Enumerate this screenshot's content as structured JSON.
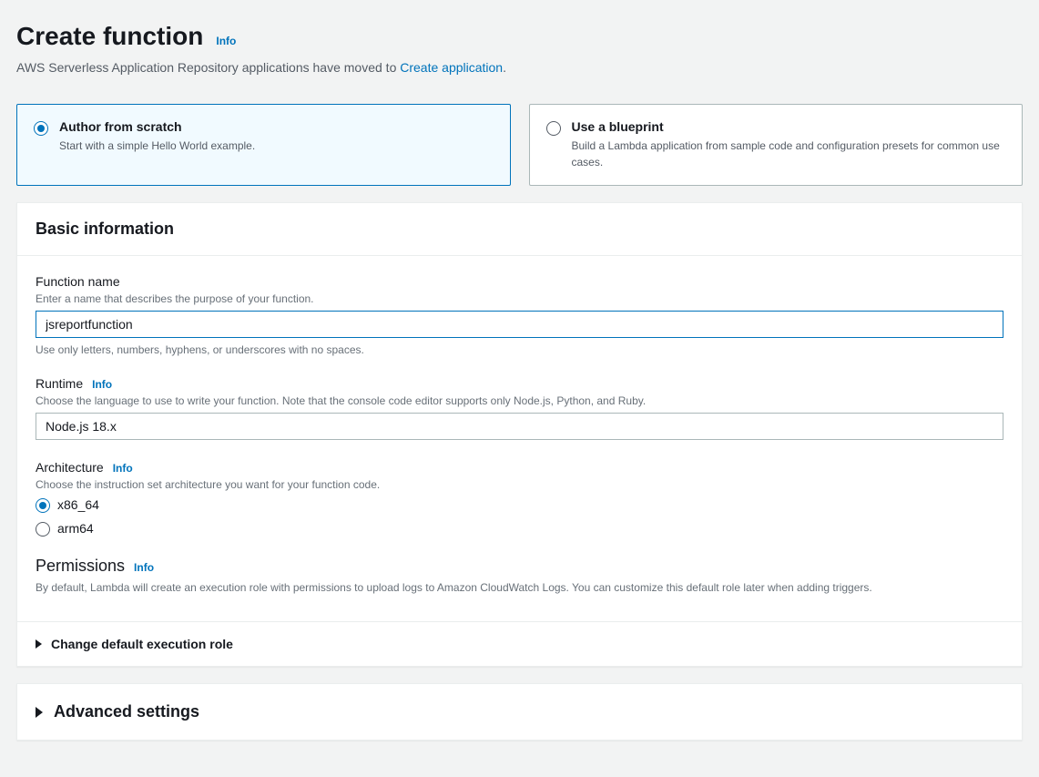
{
  "header": {
    "title": "Create function",
    "info": "Info",
    "subtext_prefix": "AWS Serverless Application Repository applications have moved to ",
    "subtext_link": "Create application",
    "subtext_suffix": "."
  },
  "options": {
    "author": {
      "title": "Author from scratch",
      "desc": "Start with a simple Hello World example.",
      "selected": true
    },
    "blueprint": {
      "title": "Use a blueprint",
      "desc": "Build a Lambda application from sample code and configuration presets for common use cases.",
      "selected": false
    }
  },
  "basic": {
    "heading": "Basic information",
    "function_name": {
      "label": "Function name",
      "hint": "Enter a name that describes the purpose of your function.",
      "value": "jsreportfunction",
      "help": "Use only letters, numbers, hyphens, or underscores with no spaces."
    },
    "runtime": {
      "label": "Runtime",
      "info": "Info",
      "hint": "Choose the language to use to write your function. Note that the console code editor supports only Node.js, Python, and Ruby.",
      "value": "Node.js 18.x"
    },
    "architecture": {
      "label": "Architecture",
      "info": "Info",
      "hint": "Choose the instruction set architecture you want for your function code.",
      "options": {
        "x86": "x86_64",
        "arm": "arm64"
      },
      "selected": "x86"
    },
    "permissions": {
      "label": "Permissions",
      "info": "Info",
      "desc": "By default, Lambda will create an execution role with permissions to upload logs to Amazon CloudWatch Logs. You can customize this default role later when adding triggers."
    },
    "execution_role": {
      "label": "Change default execution role"
    }
  },
  "advanced": {
    "label": "Advanced settings"
  }
}
